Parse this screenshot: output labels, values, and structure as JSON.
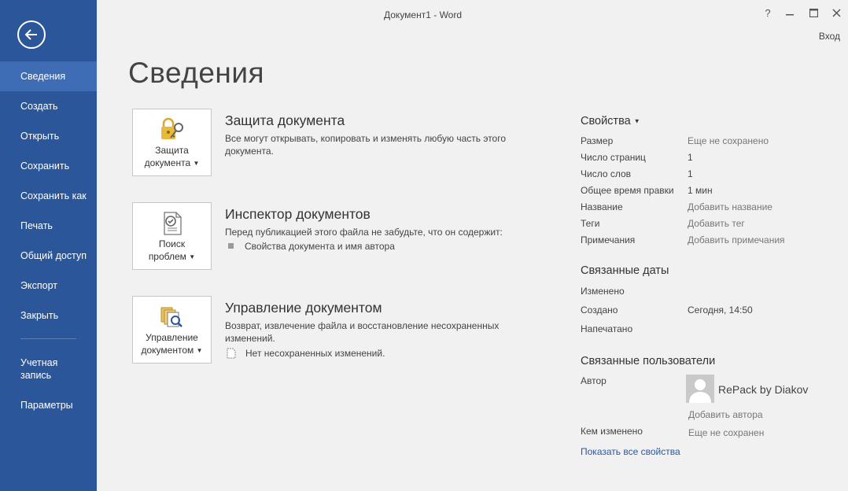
{
  "window": {
    "title": "Документ1 - Word",
    "help": "?",
    "minimize": "▁",
    "maximize": "□",
    "close": "✕",
    "signin": "Вход"
  },
  "sidebar": {
    "items": [
      {
        "label": "Сведения",
        "active": true
      },
      {
        "label": "Создать"
      },
      {
        "label": "Открыть"
      },
      {
        "label": "Сохранить"
      },
      {
        "label": "Сохранить как"
      },
      {
        "label": "Печать"
      },
      {
        "label": "Общий доступ"
      },
      {
        "label": "Экспорт"
      },
      {
        "label": "Закрыть"
      },
      {
        "label": "Учетная запись"
      },
      {
        "label": "Параметры"
      }
    ]
  },
  "page": {
    "title": "Сведения"
  },
  "sections": [
    {
      "tile_label_1": "Защита",
      "tile_label_2": "документа",
      "heading": "Защита документа",
      "text": "Все могут открывать, копировать и изменять любую часть этого документа."
    },
    {
      "tile_label_1": "Поиск",
      "tile_label_2": "проблем",
      "heading": "Инспектор документов",
      "text": "Перед публикацией этого файла не забудьте, что он содержит:",
      "bullet": "Свойства документа и имя автора"
    },
    {
      "tile_label_1": "Управление",
      "tile_label_2": "документом",
      "heading": "Управление документом",
      "text": "Возврат, извлечение файла и восстановление несохраненных изменений.",
      "bullet": "Нет несохраненных изменений."
    }
  ],
  "properties": {
    "heading": "Свойства",
    "rows": [
      {
        "label": "Размер",
        "value": "Еще не сохранено"
      },
      {
        "label": "Число страниц",
        "value": "1"
      },
      {
        "label": "Число слов",
        "value": "1"
      },
      {
        "label": "Общее время правки",
        "value": "1 мин"
      },
      {
        "label": "Название",
        "value": "Добавить название"
      },
      {
        "label": "Теги",
        "value": "Добавить тег"
      },
      {
        "label": "Примечания",
        "value": "Добавить примечания"
      }
    ]
  },
  "dates": {
    "heading": "Связанные даты",
    "rows": [
      {
        "label": "Изменено",
        "value": ""
      },
      {
        "label": "Создано",
        "value": "Сегодня, 14:50"
      },
      {
        "label": "Напечатано",
        "value": ""
      }
    ]
  },
  "people": {
    "heading": "Связанные пользователи",
    "author_label": "Автор",
    "author_name": "RePack by Diakov",
    "add_author": "Добавить автора",
    "modified_by_label": "Кем изменено",
    "modified_by_value": "Еще не сохранен"
  },
  "show_all": "Показать все свойства",
  "colors": {
    "sidebar": "#2b579a",
    "sidebar_active": "#3e6db5",
    "background": "#f1f1f1"
  }
}
